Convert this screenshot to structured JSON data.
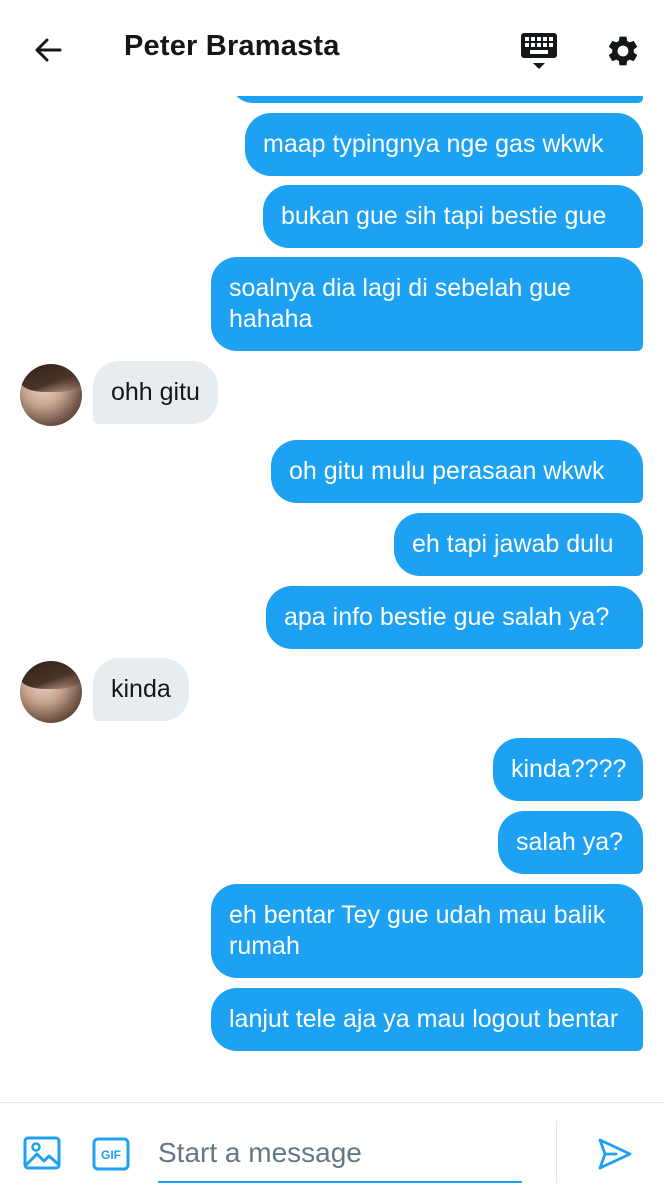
{
  "header": {
    "title": "Peter Bramasta",
    "back_icon": "arrow-left-icon",
    "keyboard_icon": "keyboard-icon",
    "settings_icon": "gear-icon"
  },
  "messages": [
    {
      "side": "out",
      "text": ""
    },
    {
      "side": "out",
      "text": "maap typingnya nge gas wkwk"
    },
    {
      "side": "out",
      "text": "bukan gue sih tapi bestie gue"
    },
    {
      "side": "out",
      "text": "soalnya dia lagi di sebelah gue hahaha"
    },
    {
      "side": "in",
      "text": "ohh gitu"
    },
    {
      "side": "out",
      "text": "oh gitu mulu perasaan wkwk"
    },
    {
      "side": "out",
      "text": "eh tapi jawab dulu"
    },
    {
      "side": "out",
      "text": "apa info bestie gue salah ya?"
    },
    {
      "side": "in",
      "text": "kinda"
    },
    {
      "side": "out",
      "text": "kinda????"
    },
    {
      "side": "out",
      "text": "salah ya?"
    },
    {
      "side": "out",
      "text": "eh bentar Tey gue udah mau balik rumah"
    },
    {
      "side": "out",
      "text": "lanjut tele aja ya mau logout bentar"
    }
  ],
  "composer": {
    "placeholder": "Start a message",
    "value": "",
    "image_icon": "image-icon",
    "gif_icon": "gif-icon",
    "gif_label": "GIF",
    "send_icon": "send-icon"
  },
  "colors": {
    "outgoing_bubble": "#1da1f2",
    "incoming_bubble": "#e6ecf0",
    "accent": "#1da1f2"
  }
}
